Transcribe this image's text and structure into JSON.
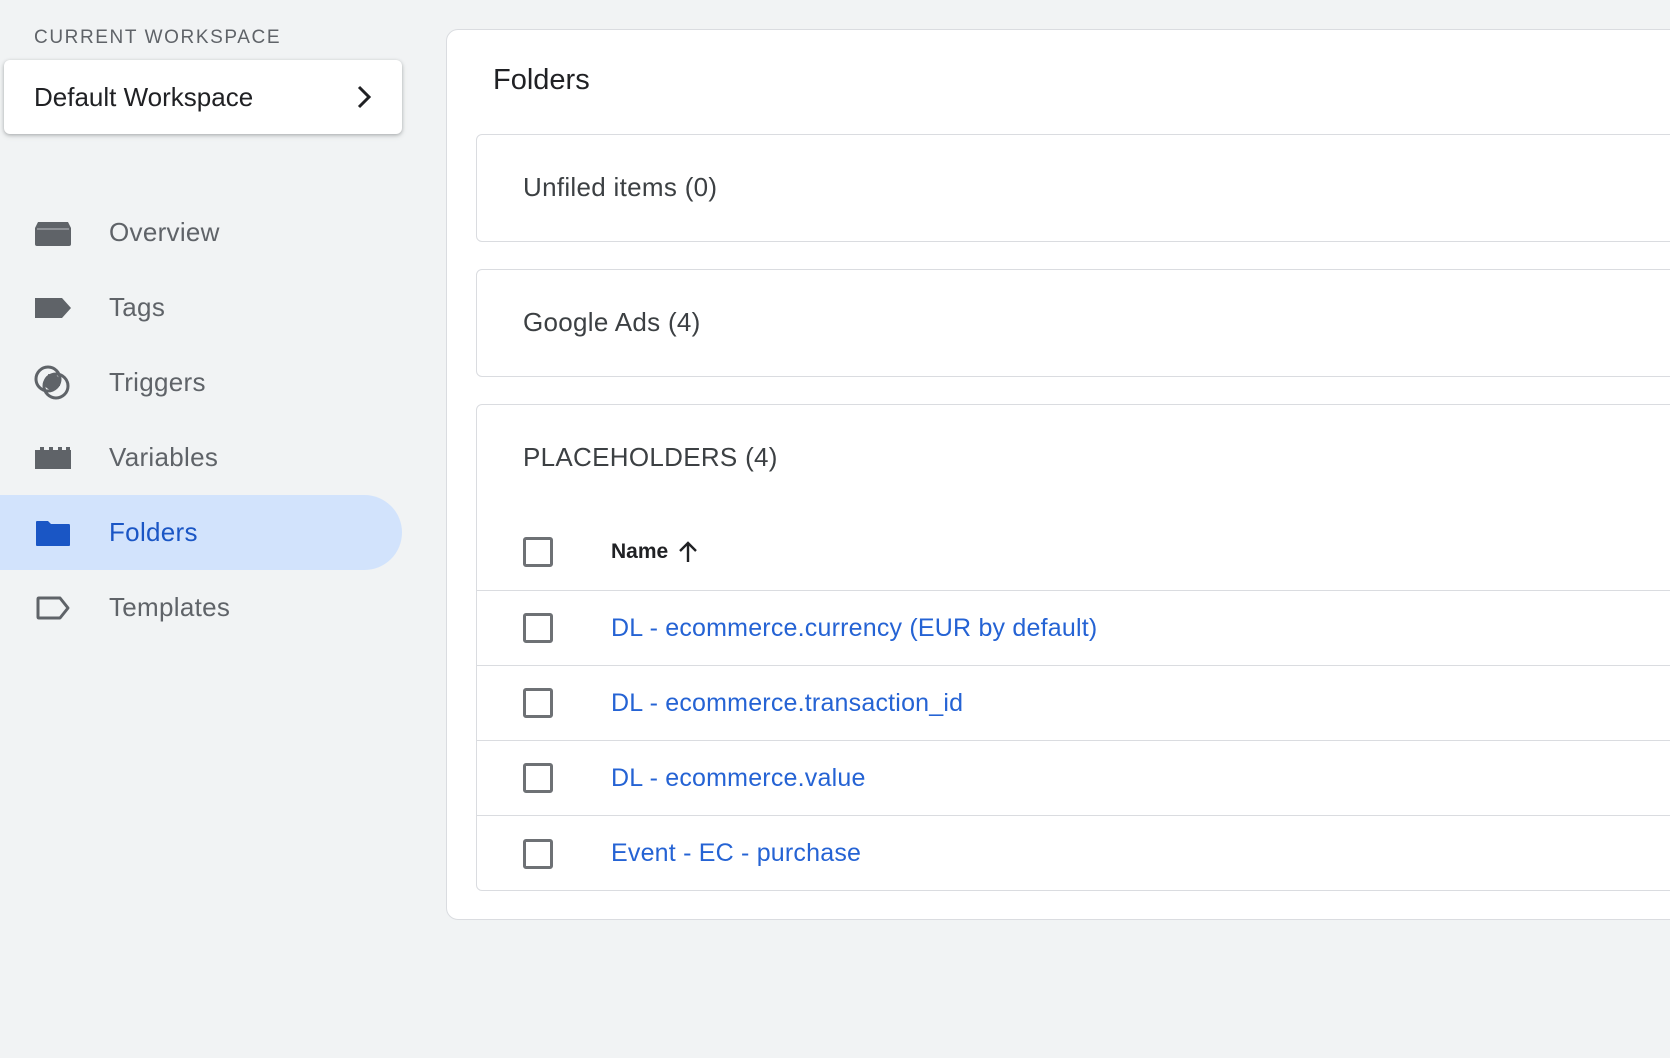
{
  "workspace": {
    "section_label": "CURRENT WORKSPACE",
    "name": "Default Workspace"
  },
  "nav": {
    "items": [
      {
        "label": "Overview",
        "icon": "overview-icon"
      },
      {
        "label": "Tags",
        "icon": "tag-icon"
      },
      {
        "label": "Triggers",
        "icon": "trigger-icon"
      },
      {
        "label": "Variables",
        "icon": "variables-icon"
      },
      {
        "label": "Folders",
        "icon": "folder-icon",
        "active": true
      },
      {
        "label": "Templates",
        "icon": "template-icon"
      }
    ]
  },
  "main": {
    "title": "Folders",
    "folders": [
      {
        "title": "Unfiled items (0)"
      },
      {
        "title": "Google Ads (4)"
      },
      {
        "title": "PLACEHOLDERS (4)",
        "table": {
          "column": "Name",
          "sort": "ascending",
          "rows": [
            "DL - ecommerce.currency (EUR by default)",
            "DL - ecommerce.transaction_id",
            "DL - ecommerce.value",
            "Event - EC - purchase"
          ]
        }
      }
    ]
  },
  "colors": {
    "background": "#f1f3f4",
    "active_nav_bg": "#d2e3fc",
    "active_nav_text": "#1a56c5",
    "link": "#2563d4",
    "icon_gray": "#5f6368"
  }
}
